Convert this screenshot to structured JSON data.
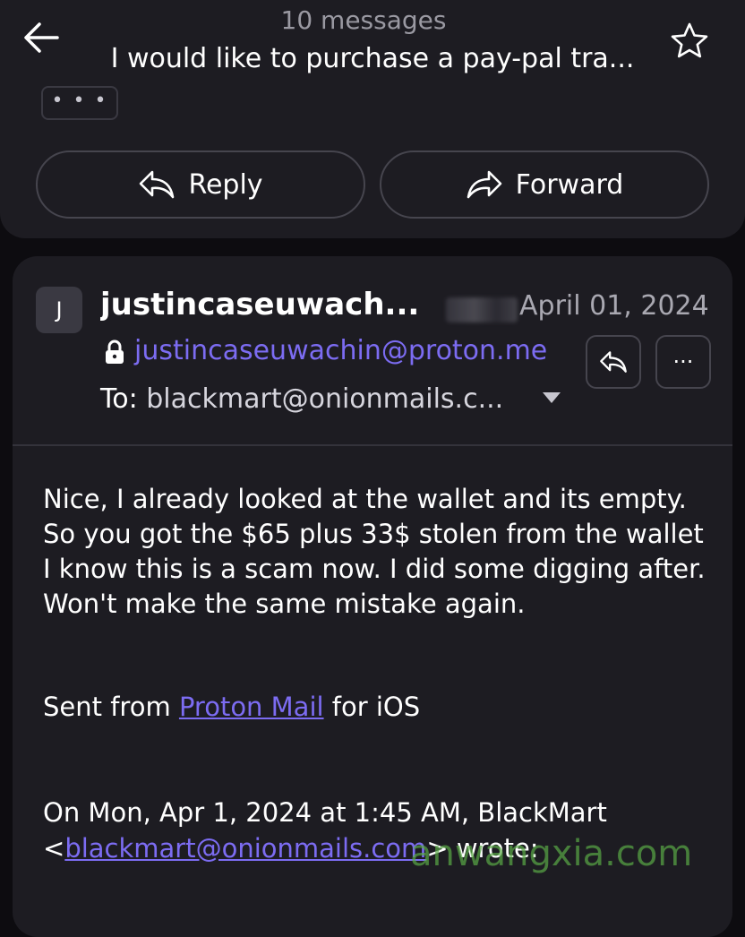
{
  "header": {
    "message_count": "10 messages",
    "subject": "I would like to purchase a pay-pal tra..."
  },
  "prev_message": {
    "ellipsis": "• • •",
    "reply_label": "Reply",
    "forward_label": "Forward"
  },
  "message": {
    "avatar_initial": "J",
    "sender_name": "justincaseuwach...",
    "date": "April 01, 2024",
    "sender_email": "justincaseuwachin@proton.me",
    "to_label": "To:",
    "to_address": "blackmart@onionmails.c...",
    "more_label": "···",
    "body": "Nice, I already looked at the wallet and its empty. So you got the $65 plus 33$ stolen from the wallet I know this is a scam now. I did some digging after. Won't make the same mistake again.",
    "sent_from_prefix": "Sent from ",
    "sent_from_link": "Proton Mail",
    "sent_from_suffix": " for iOS",
    "quote_line1": "On Mon, Apr 1, 2024 at 1:45 AM, BlackMart",
    "quote_open": "<",
    "quote_email": "blackmart@onionmails.com",
    "quote_close": "> wrote:"
  },
  "watermark": "anwangxia.com",
  "colors": {
    "background": "#0d0c10",
    "card": "#1d1c22",
    "accent_link": "#7c6cf2",
    "secondary_text": "#a9a8b1"
  },
  "icons": [
    "back-arrow-icon",
    "star-icon",
    "reply-icon",
    "forward-icon",
    "lock-icon",
    "chevron-down-icon",
    "more-icon"
  ]
}
